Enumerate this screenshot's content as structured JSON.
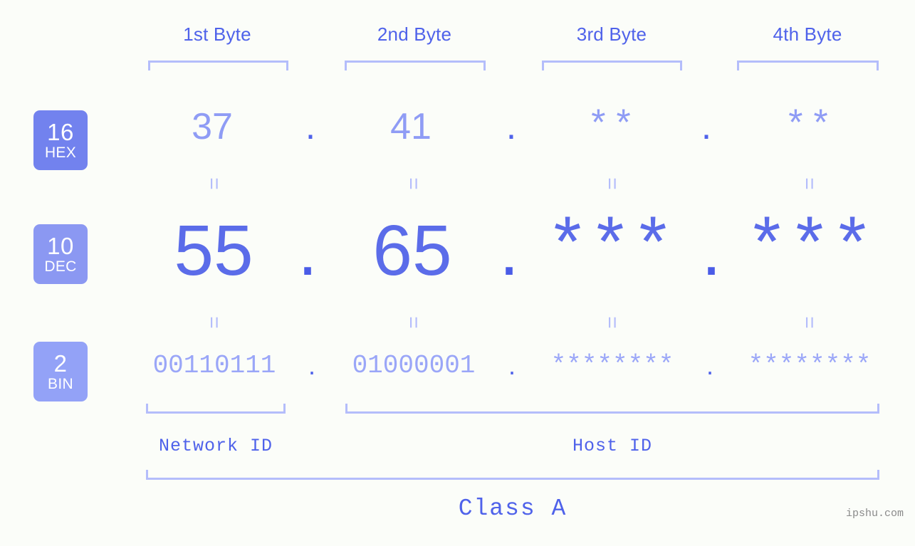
{
  "meta": {
    "background": "#fbfdf9",
    "accent": "#4f62ea",
    "accent_light": "#b4bdfb",
    "watermark": "ipshu.com"
  },
  "byte_headers": [
    {
      "label": "1st Byte"
    },
    {
      "label": "2nd Byte"
    },
    {
      "label": "3rd Byte"
    },
    {
      "label": "4th Byte"
    }
  ],
  "rows": [
    {
      "base": "16",
      "name": "HEX",
      "badge_color": "#7282ee",
      "values": [
        "37",
        "41",
        "**",
        "**"
      ],
      "separator": "."
    },
    {
      "base": "10",
      "name": "DEC",
      "badge_color": "#8b98f2",
      "values": [
        "55",
        "65",
        "***",
        "***"
      ],
      "separator": "."
    },
    {
      "base": "2",
      "name": "BIN",
      "badge_color": "#93a2f7",
      "values": [
        "00110111",
        "01000001",
        "********",
        "********"
      ],
      "separator": "."
    }
  ],
  "equals_glyph": "=",
  "segments": {
    "network_id": "Network ID",
    "host_id": "Host ID",
    "class": "Class A"
  }
}
